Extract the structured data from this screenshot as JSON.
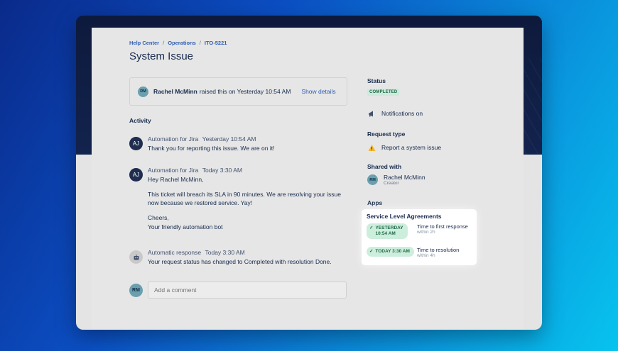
{
  "breadcrumb": [
    "Help Center",
    "Operations",
    "ITO-5221"
  ],
  "page_title": "System Issue",
  "raised": {
    "avatar": "RM",
    "name": "Rachel McMinn",
    "text": "raised this on Yesterday 10:54 AM",
    "show_details": "Show details"
  },
  "activity": {
    "label": "Activity",
    "entries": [
      {
        "avatar": "AJ",
        "author": "Automation for Jira",
        "time": "Yesterday 10:54 AM",
        "lines": [
          "Thank you for reporting this issue. We are on it!"
        ]
      },
      {
        "avatar": "AJ",
        "author": "Automation for Jira",
        "time": "Today 3:30 AM",
        "lines": [
          "Hey Rachel McMinn,",
          "This ticket will breach its SLA in 90 minutes. We are resolving your issue now because we restored service. Yay!",
          "Cheers,",
          "Your friendly automation bot"
        ]
      },
      {
        "avatar_icon": "robot-icon",
        "author": "Automatic response",
        "time": "Today 3:30 AM",
        "lines": [
          "Your request status has changed to Completed with resolution Done."
        ]
      }
    ]
  },
  "comment": {
    "avatar": "RM",
    "placeholder": "Add a comment"
  },
  "sidebar": {
    "status_label": "Status",
    "status_value": "COMPLETED",
    "notifications": "Notifications on",
    "request_type_label": "Request type",
    "request_type_value": "Report a system issue",
    "shared_label": "Shared with",
    "shared_avatar": "RM",
    "shared_name": "Rachel McMinn",
    "shared_role": "Creator",
    "apps_label": "Apps"
  },
  "sla": {
    "title": "Service Level Agreements",
    "items": [
      {
        "badge_line1": "YESTERDAY",
        "badge_line2": "10:54 AM",
        "name": "Time to first response",
        "within": "within 2h"
      },
      {
        "badge_line1": "TODAY 3:30 AM",
        "badge_line2": "",
        "name": "Time to resolution",
        "within": "within 4h"
      }
    ]
  },
  "colors": {
    "link": "#2f5fb3",
    "success_bg": "#cde9dc",
    "success_text": "#1e6b46",
    "dark_avatar": "#1f2d4e"
  }
}
